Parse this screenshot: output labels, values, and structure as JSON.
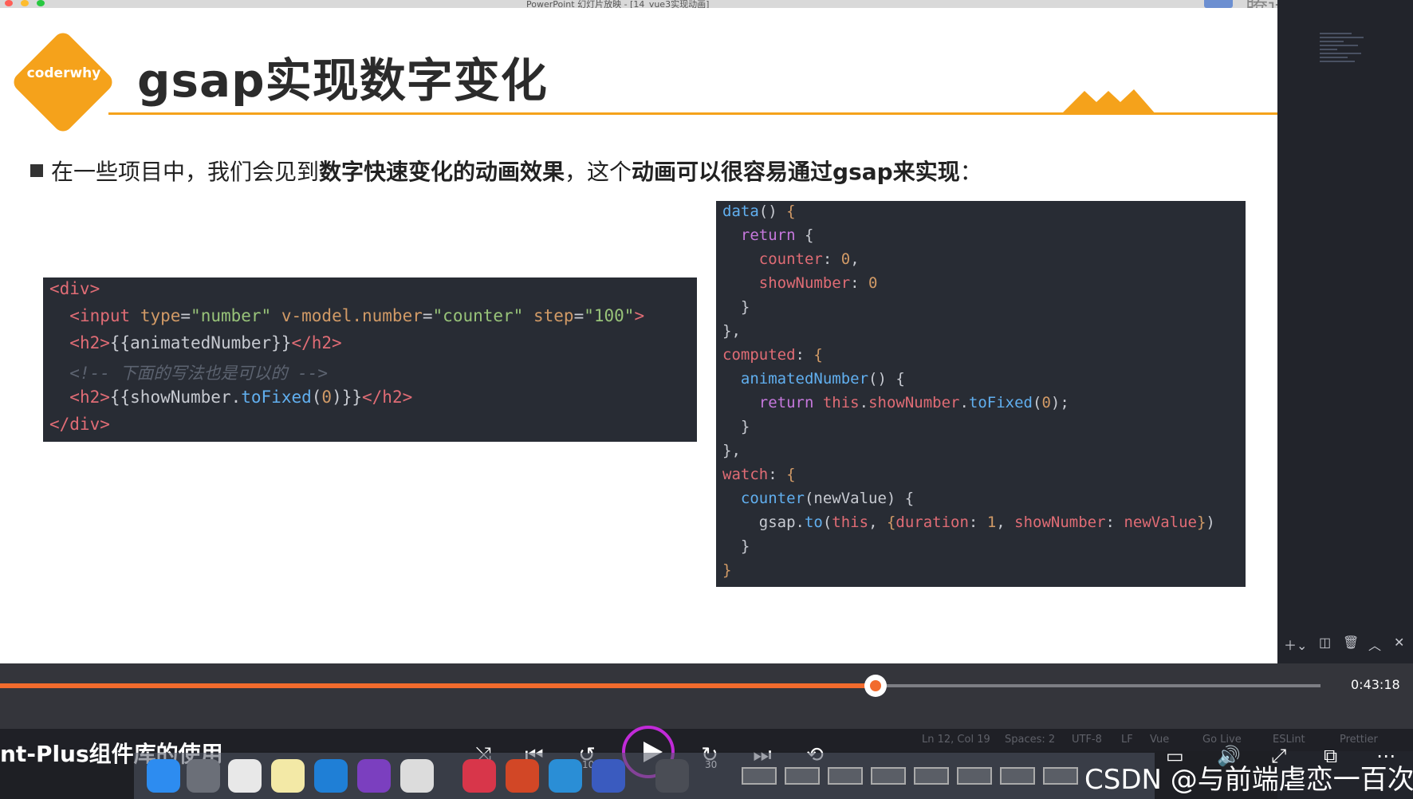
{
  "window": {
    "title": "PowerPoint 幻灯片放映 - [14_vue3实现动画]",
    "top_right_text": "腾讯课堂"
  },
  "slide": {
    "logo_text": "coderwhy",
    "title": "gsap实现数字变化",
    "bullet": {
      "part1": "在一些项目中，我们会见到",
      "bold1": "数字快速变化的动画效果",
      "part2": "，这个",
      "bold2": "动画可以很容易通过gsap来实现",
      "part3": "："
    },
    "template_code": [
      "<div>",
      "  <input type=\"number\" v-model.number=\"counter\" step=\"100\">",
      "  <h2>{{animatedNumber}}</h2>",
      "  <!-- 下面的写法也是可以的 -->",
      "  <h2>{{showNumber.toFixed(0)}}</h2>",
      "</div>"
    ],
    "script_code": [
      "data() {",
      "  return {",
      "    counter: 0,",
      "    showNumber: 0",
      "  }",
      "},",
      "computed: {",
      "  animatedNumber() {",
      "    return this.showNumber.toFixed(0);",
      "  }",
      "},",
      "watch: {",
      "  counter(newValue) {",
      "    gsap.to(this, {duration: 1, showNumber: newValue})",
      "  }",
      "}"
    ]
  },
  "player": {
    "progress": 0.663,
    "time": "0:43:18",
    "course_title": "nt-Plus组件库的使用",
    "rewind_label": "10",
    "forward_label": "30"
  },
  "status_bar": [
    "Ln 12, Col 19",
    "Spaces: 2",
    "UTF-8",
    "LF",
    "Vue",
    "Go Live",
    "ESLint",
    "Prettier"
  ],
  "watermark": "CSDN @与前端虐恋一百次",
  "colors": {
    "accent": "#f5a21b",
    "progress": "#f26b2d",
    "play_ring": "#c12ad8"
  }
}
